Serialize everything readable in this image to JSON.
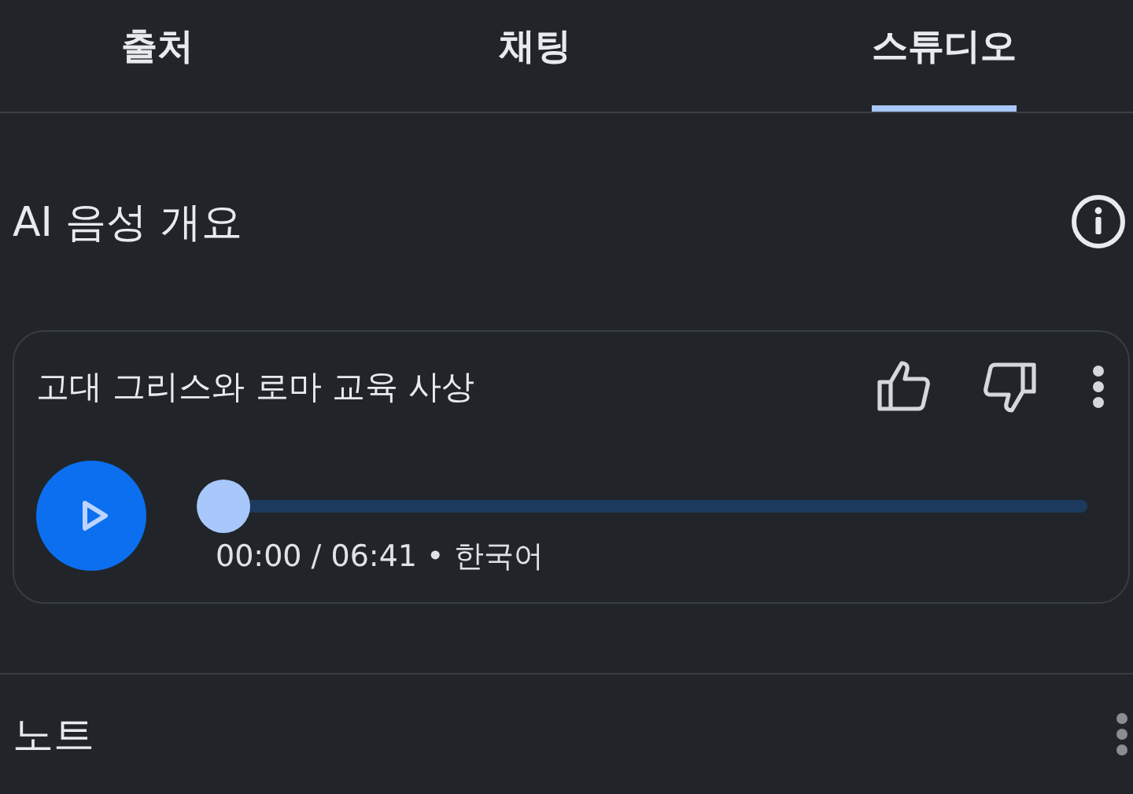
{
  "tabs": [
    {
      "label": "출처",
      "selected": false
    },
    {
      "label": "채팅",
      "selected": false
    },
    {
      "label": "스튜디오",
      "selected": true
    }
  ],
  "audio_overview": {
    "heading": "AI 음성 개요",
    "player": {
      "title": "고대 그리스와 로마 교육 사상",
      "level": 0,
      "info": "00:00 / 06:41 • 한국어"
    }
  },
  "notes": {
    "heading": "노트"
  }
}
